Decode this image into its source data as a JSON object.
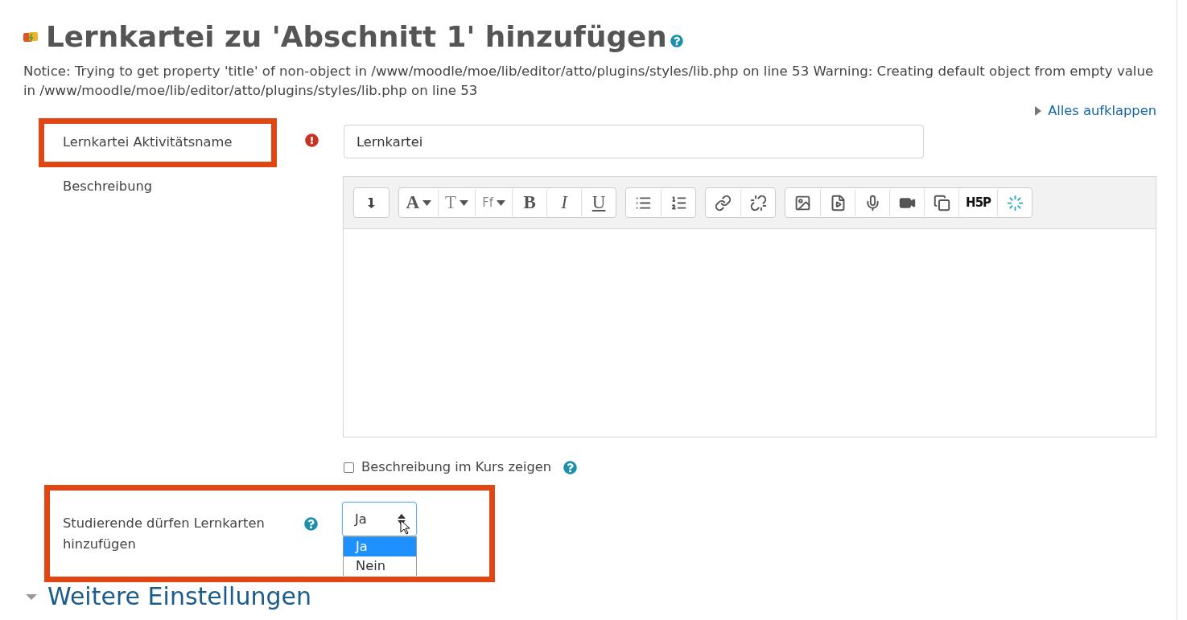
{
  "page": {
    "title": "Lernkartei zu 'Abschnitt 1' hinzufügen",
    "notice": "Notice: Trying to get property 'title' of non-object in /www/moodle/moe/lib/editor/atto/plugins/styles/lib.php on line 53 Warning: Creating default object from empty value in /www/moodle/moe/lib/editor/atto/plugins/styles/lib.php on line 53",
    "expand_all": "Alles aufklappen"
  },
  "name_field": {
    "label": "Lernkartei Aktivitätsname",
    "required": true,
    "value": "Lernkartei",
    "highlighted": true
  },
  "description": {
    "label": "Beschreibung",
    "toolbar": [
      [
        {
          "kind": "collapse"
        }
      ],
      [
        {
          "kind": "text",
          "label": "A",
          "caret": true
        },
        {
          "kind": "text",
          "label": "T",
          "caret": true
        },
        {
          "kind": "text",
          "label": "Ff",
          "caret": true
        },
        {
          "kind": "text",
          "label": "B",
          "caret": false
        },
        {
          "kind": "text",
          "label": "I",
          "caret": false
        },
        {
          "kind": "text",
          "label": "U",
          "caret": false
        }
      ],
      [
        {
          "kind": "bullets"
        },
        {
          "kind": "numbers"
        }
      ],
      [
        {
          "kind": "link"
        },
        {
          "kind": "unlink"
        }
      ],
      [
        {
          "kind": "image"
        },
        {
          "kind": "media"
        },
        {
          "kind": "mic"
        },
        {
          "kind": "video"
        },
        {
          "kind": "copy"
        },
        {
          "kind": "text",
          "label": "H5P",
          "caret": false
        },
        {
          "kind": "spark"
        }
      ]
    ],
    "show_in_course": {
      "label": "Beschreibung im Kurs zeigen",
      "checked": false
    }
  },
  "students_add": {
    "label": "Studierende dürfen Lernkarten hinzufügen",
    "value": "Ja",
    "highlighted": true,
    "options": [
      {
        "label": "Ja",
        "selected": true
      },
      {
        "label": "Nein",
        "selected": false
      }
    ]
  },
  "section": {
    "title": "Weitere Einstellungen",
    "expanded": false
  }
}
